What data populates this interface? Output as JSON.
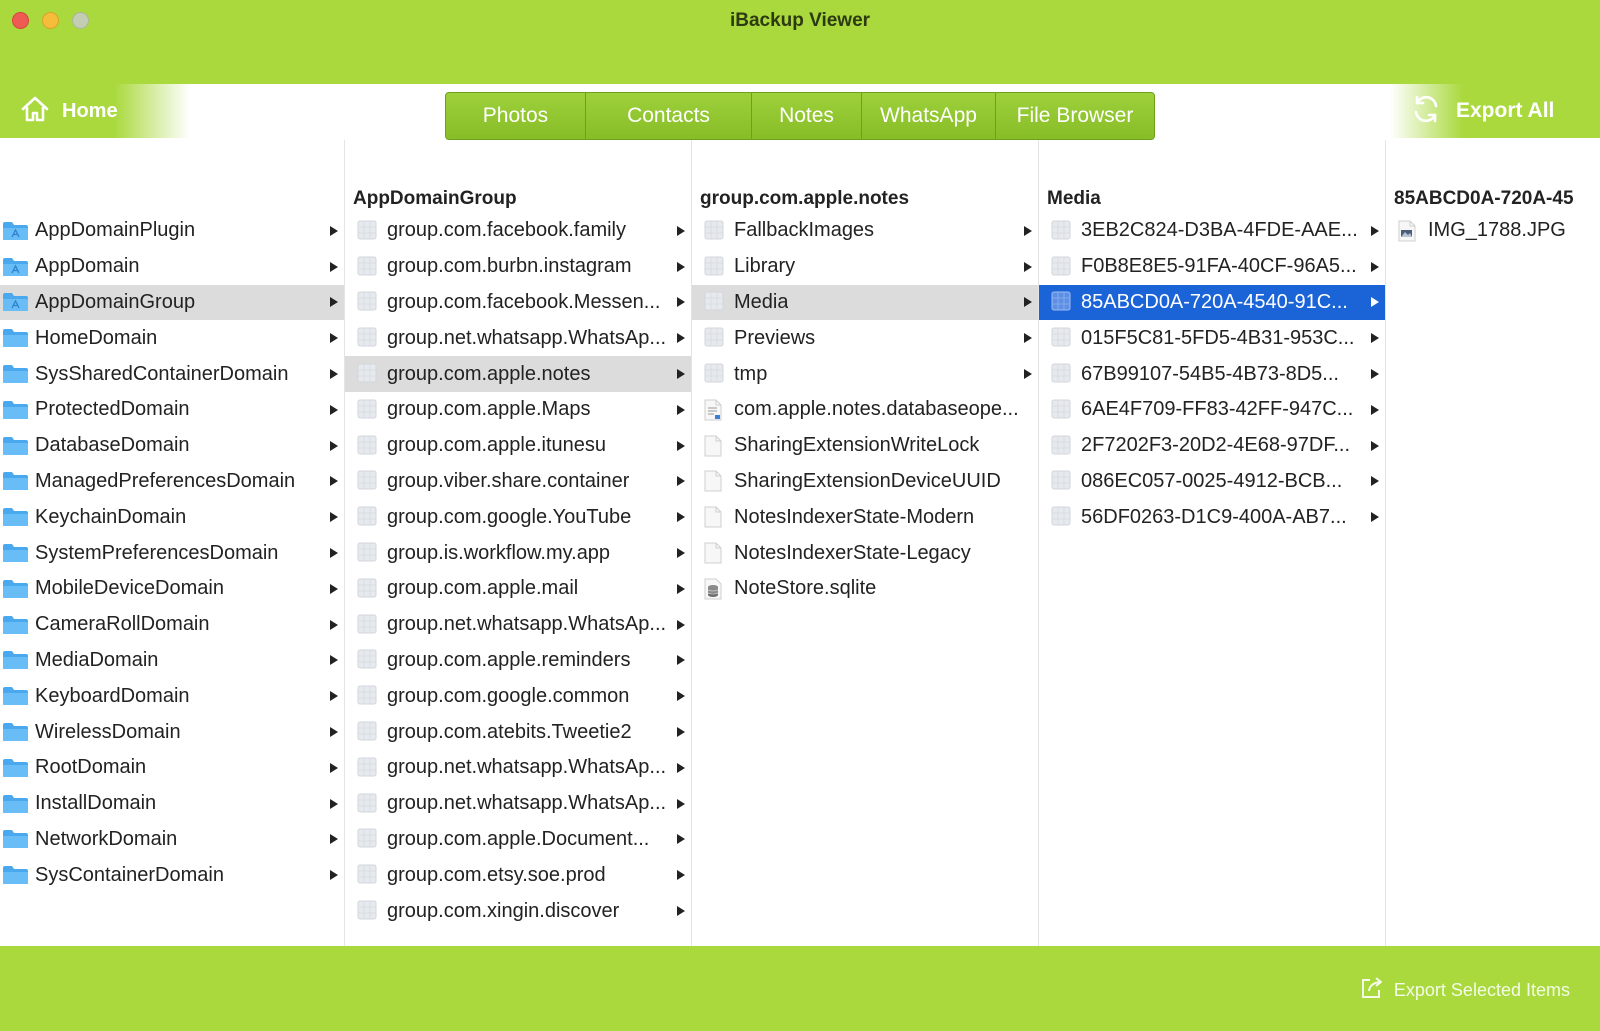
{
  "window": {
    "title": "iBackup Viewer"
  },
  "toolbar": {
    "home_label": "Home",
    "export_all_label": "Export All",
    "tabs": [
      {
        "label": "Photos"
      },
      {
        "label": "Contacts"
      },
      {
        "label": "Notes"
      },
      {
        "label": "WhatsApp"
      },
      {
        "label": "File Browser"
      }
    ]
  },
  "columns": {
    "domains": {
      "header": "",
      "items": [
        {
          "label": "AppDomainPlugin",
          "icon": "app-folder-icon"
        },
        {
          "label": "AppDomain",
          "icon": "app-folder-icon"
        },
        {
          "label": "AppDomainGroup",
          "icon": "app-folder-icon",
          "selected": "gray"
        },
        {
          "label": "HomeDomain",
          "icon": "folder-icon"
        },
        {
          "label": "SysSharedContainerDomain",
          "icon": "folder-icon"
        },
        {
          "label": "ProtectedDomain",
          "icon": "folder-icon"
        },
        {
          "label": "DatabaseDomain",
          "icon": "folder-icon"
        },
        {
          "label": "ManagedPreferencesDomain",
          "icon": "folder-icon"
        },
        {
          "label": "KeychainDomain",
          "icon": "folder-icon"
        },
        {
          "label": "SystemPreferencesDomain",
          "icon": "folder-icon"
        },
        {
          "label": "MobileDeviceDomain",
          "icon": "folder-icon"
        },
        {
          "label": "CameraRollDomain",
          "icon": "folder-icon"
        },
        {
          "label": "MediaDomain",
          "icon": "folder-icon"
        },
        {
          "label": "KeyboardDomain",
          "icon": "folder-icon"
        },
        {
          "label": "WirelessDomain",
          "icon": "folder-icon"
        },
        {
          "label": "RootDomain",
          "icon": "folder-icon"
        },
        {
          "label": "InstallDomain",
          "icon": "folder-icon"
        },
        {
          "label": "NetworkDomain",
          "icon": "folder-icon"
        },
        {
          "label": "SysContainerDomain",
          "icon": "folder-icon"
        }
      ]
    },
    "app_domain_group": {
      "header": "AppDomainGroup",
      "items": [
        {
          "label": "group.com.facebook.family"
        },
        {
          "label": "group.com.burbn.instagram"
        },
        {
          "label": "group.com.facebook.Messen..."
        },
        {
          "label": "group.net.whatsapp.WhatsAp..."
        },
        {
          "label": "group.com.apple.notes",
          "selected": "gray"
        },
        {
          "label": "group.com.apple.Maps"
        },
        {
          "label": "group.com.apple.itunesu"
        },
        {
          "label": "group.viber.share.container"
        },
        {
          "label": "group.com.google.YouTube"
        },
        {
          "label": "group.is.workflow.my.app"
        },
        {
          "label": "group.com.apple.mail"
        },
        {
          "label": "group.net.whatsapp.WhatsAp..."
        },
        {
          "label": "group.com.apple.reminders"
        },
        {
          "label": "group.com.google.common"
        },
        {
          "label": "group.com.atebits.Tweetie2"
        },
        {
          "label": "group.net.whatsapp.WhatsAp..."
        },
        {
          "label": "group.net.whatsapp.WhatsAp..."
        },
        {
          "label": "group.com.apple.Document..."
        },
        {
          "label": "group.com.etsy.soe.prod"
        },
        {
          "label": "group.com.xingin.discover"
        }
      ]
    },
    "notes_group": {
      "header": "group.com.apple.notes",
      "items": [
        {
          "label": "FallbackImages",
          "kind": "folder"
        },
        {
          "label": "Library",
          "kind": "folder"
        },
        {
          "label": "Media",
          "kind": "folder",
          "selected": "gray"
        },
        {
          "label": "Previews",
          "kind": "folder"
        },
        {
          "label": "tmp",
          "kind": "folder"
        },
        {
          "label": "com.apple.notes.databaseope...",
          "kind": "doc"
        },
        {
          "label": "SharingExtensionWriteLock",
          "kind": "file"
        },
        {
          "label": "SharingExtensionDeviceUUID",
          "kind": "file"
        },
        {
          "label": "NotesIndexerState-Modern",
          "kind": "file"
        },
        {
          "label": "NotesIndexerState-Legacy",
          "kind": "file"
        },
        {
          "label": "NoteStore.sqlite",
          "kind": "db"
        }
      ]
    },
    "media": {
      "header": "Media",
      "items": [
        {
          "label": "3EB2C824-D3BA-4FDE-AAE..."
        },
        {
          "label": "F0B8E8E5-91FA-40CF-96A5..."
        },
        {
          "label": "85ABCD0A-720A-4540-91C...",
          "selected": "blue"
        },
        {
          "label": "015F5C81-5FD5-4B31-953C..."
        },
        {
          "label": "67B99107-54B5-4B73-8D5..."
        },
        {
          "label": "6AE4F709-FF83-42FF-947C..."
        },
        {
          "label": "2F7202F3-20D2-4E68-97DF..."
        },
        {
          "label": "086EC057-0025-4912-BCB..."
        },
        {
          "label": "56DF0263-D1C9-400A-AB7..."
        }
      ]
    },
    "media_item": {
      "header": "85ABCD0A-720A-45",
      "items": [
        {
          "label": "IMG_1788.JPG",
          "kind": "image"
        }
      ]
    }
  },
  "bottom": {
    "export_selected_label": "Export Selected Items"
  },
  "colors": {
    "accent_green": "#a9d93c",
    "selection_blue": "#1b64d8",
    "selection_gray": "#dcdcdc"
  }
}
